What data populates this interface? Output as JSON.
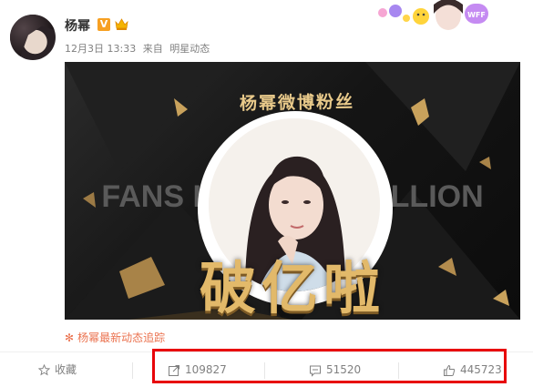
{
  "post": {
    "username": "杨幂",
    "verified_badge": "V",
    "timestamp": "12月3日 13:33",
    "source_prefix": "来自",
    "source_name": "明星动态"
  },
  "media": {
    "arc_title": "杨幂微博粉丝",
    "bg_text": "FANS HUNDRED MILLION",
    "main_title": "破亿啦"
  },
  "topic_link": {
    "icon": "flower-icon",
    "text": "杨幂最新动态追踪"
  },
  "actions": {
    "favorite_label": "收藏",
    "repost_count": "109827",
    "comment_count": "51520",
    "like_count": "445723"
  },
  "colors": {
    "accent_orange": "#eb7350",
    "highlight_red": "#e8040a",
    "gold": "#e2b96a"
  }
}
